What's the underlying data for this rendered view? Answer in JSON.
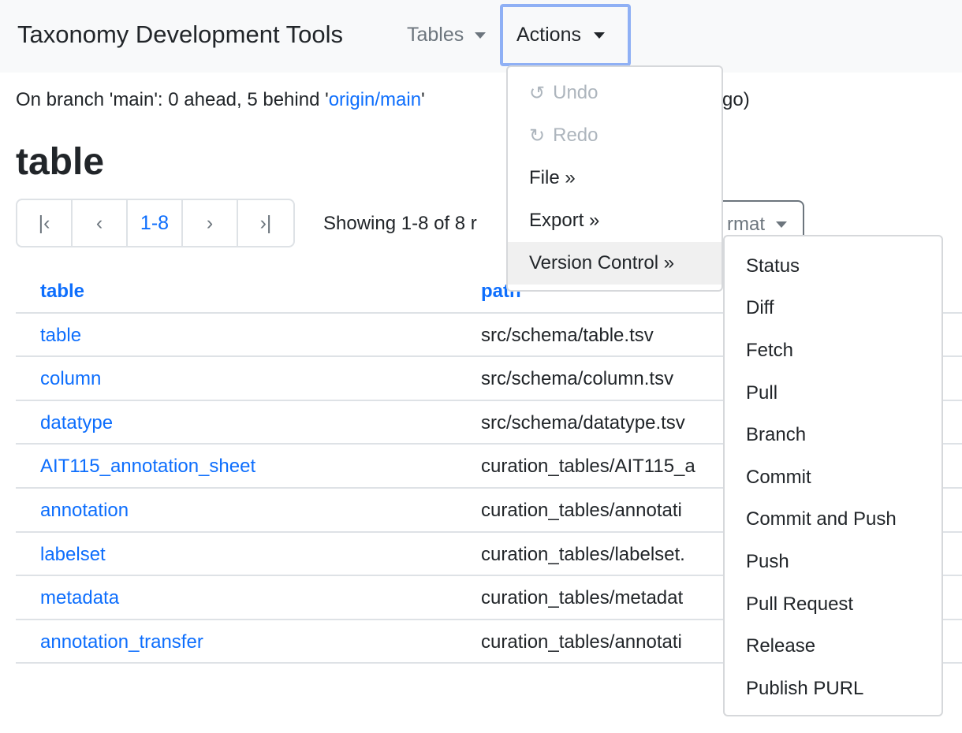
{
  "navbar": {
    "brand": "Taxonomy Development Tools",
    "tables_label": "Tables",
    "actions_label": "Actions"
  },
  "status": {
    "prefix": "On branch 'main': 0 ahead, 5 behind '",
    "remote": "origin/main",
    "suffix": "'",
    "tail": "go)"
  },
  "page_title": "table",
  "pager": {
    "first": "|‹",
    "prev": "‹",
    "current": "1-8",
    "next": "›",
    "last": "›|"
  },
  "showing": "Showing 1-8 of 8 r",
  "format_label": "rmat",
  "table": {
    "headers": [
      "table",
      "path"
    ],
    "rows": [
      [
        "table",
        "src/schema/table.tsv"
      ],
      [
        "column",
        "src/schema/column.tsv"
      ],
      [
        "datatype",
        "src/schema/datatype.tsv"
      ],
      [
        "AIT115_annotation_sheet",
        "curation_tables/AIT115_a"
      ],
      [
        "annotation",
        "curation_tables/annotati"
      ],
      [
        "labelset",
        "curation_tables/labelset."
      ],
      [
        "metadata",
        "curation_tables/metadat"
      ],
      [
        "annotation_transfer",
        "curation_tables/annotati"
      ]
    ]
  },
  "actions_menu": [
    {
      "label": "Undo",
      "icon": "undo-icon",
      "disabled": true
    },
    {
      "label": "Redo",
      "icon": "redo-icon",
      "disabled": true
    },
    {
      "label": "File »"
    },
    {
      "label": "Export »"
    },
    {
      "label": "Version Control »",
      "active": true
    }
  ],
  "version_control_menu": [
    "Status",
    "Diff",
    "Fetch",
    "Pull",
    "Branch",
    "Commit",
    "Commit and Push",
    "Push",
    "Pull Request",
    "Release",
    "Publish PURL"
  ]
}
